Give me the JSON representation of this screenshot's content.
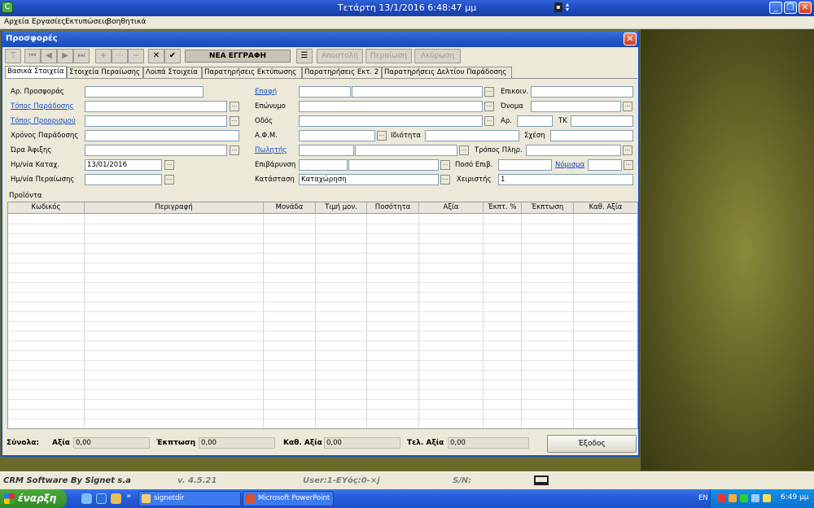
{
  "window": {
    "title": "Τετάρτη  13/1/2016 6:48:47 μμ",
    "controls": [
      "minimize",
      "restore",
      "close"
    ]
  },
  "menu": [
    "Αρχεία",
    "Εργασίες",
    "Εκτυπώσεις",
    "Βοηθητικά"
  ],
  "dialog": {
    "title": "Προσφορές",
    "toolbar": {
      "new_record": "ΝΕΑ ΕΓΓΡΑΦΗ",
      "send": "Αποστολή",
      "complete": "Περαίωση",
      "cancel": "Ακύρωση"
    },
    "tabs": [
      "Βασικά Στοιχεία",
      "Στοιχεία Περαίωσης",
      "Λοιπά Στοιχεία",
      "Παρατηρήσεις Εκτύπωσης",
      "Παρατηρήσεις Εκτ. 2",
      "Παρατηρήσεις Δελτίου Παράδοσης"
    ],
    "form": {
      "offer_no": {
        "label": "Αρ. Προσφοράς",
        "value": ""
      },
      "delivery_place": {
        "label": "Τόπος Παράδοσης",
        "value": ""
      },
      "destination": {
        "label": "Τόπος Προορισμού",
        "value": ""
      },
      "delivery_time": {
        "label": "Χρόνος Παράδοσης",
        "value": ""
      },
      "arrival_time": {
        "label": "Ώρα Άφιξης",
        "value": ""
      },
      "entry_date": {
        "label": "Ημ/νία Καταχ.",
        "value": "13/01/2016"
      },
      "completion_date": {
        "label": "Ημ/νία Περαίωσης",
        "value": ""
      },
      "contact": {
        "label": "Επαφή",
        "value": ""
      },
      "surname": {
        "label": "Επώνυμο",
        "value": ""
      },
      "street": {
        "label": "Οδός",
        "value": ""
      },
      "vat": {
        "label": "Α.Φ.Μ.",
        "value": ""
      },
      "property": {
        "label": "Ιδιότητα",
        "value": ""
      },
      "salesman": {
        "label": "Πωλητής",
        "value": ""
      },
      "charge": {
        "label": "Επιβάρυνση",
        "value": ""
      },
      "status": {
        "label": "Κατάσταση",
        "value": "Καταχώρηση"
      },
      "communication": {
        "label": "Επικοιν.",
        "value": ""
      },
      "name": {
        "label": "Όνομα",
        "value": ""
      },
      "number": {
        "label": "Αρ.",
        "value": ""
      },
      "postcode": {
        "label": "ΤΚ",
        "value": ""
      },
      "relation": {
        "label": "Σχέση",
        "value": ""
      },
      "payment_method": {
        "label": "Τρόπος Πληρ.",
        "value": ""
      },
      "charge_amount": {
        "label": "Ποσό Επιβ.",
        "value": ""
      },
      "currency": {
        "label": "Νόμισμα",
        "value": ""
      },
      "operator": {
        "label": "Χειριστής",
        "value": "1"
      }
    },
    "products_title": "Προϊόντα",
    "columns": [
      "Κωδικός",
      "Περιγραφή",
      "Μονάδα",
      "Τιμή μον.",
      "Ποσότητα",
      "Αξία",
      "Έκπτ. %",
      "Έκπτωση",
      "Καθ. Αξία"
    ],
    "totals": {
      "label": "Σύνολα:",
      "value_label": "Αξία",
      "value": "0,00",
      "discount_label": "Έκπτωση",
      "discount": "0,00",
      "net_label": "Καθ. Αξία",
      "net": "0,00",
      "total_label": "Τελ. Αξία",
      "total": "0,00"
    },
    "exit": "Έξοδος"
  },
  "statusbar": {
    "product": "CRM Software By Signet s.a",
    "version": "v. 4.5.21",
    "user": "User:1-ΕΥόç:0-×j",
    "sn": "S/N:"
  },
  "taskbar": {
    "start": "έναρξη",
    "chevron": "»",
    "tasks": [
      "signetdir",
      "Microsoft PowerPoint ..."
    ],
    "lang": "EN",
    "clock": "6:49 μμ"
  }
}
